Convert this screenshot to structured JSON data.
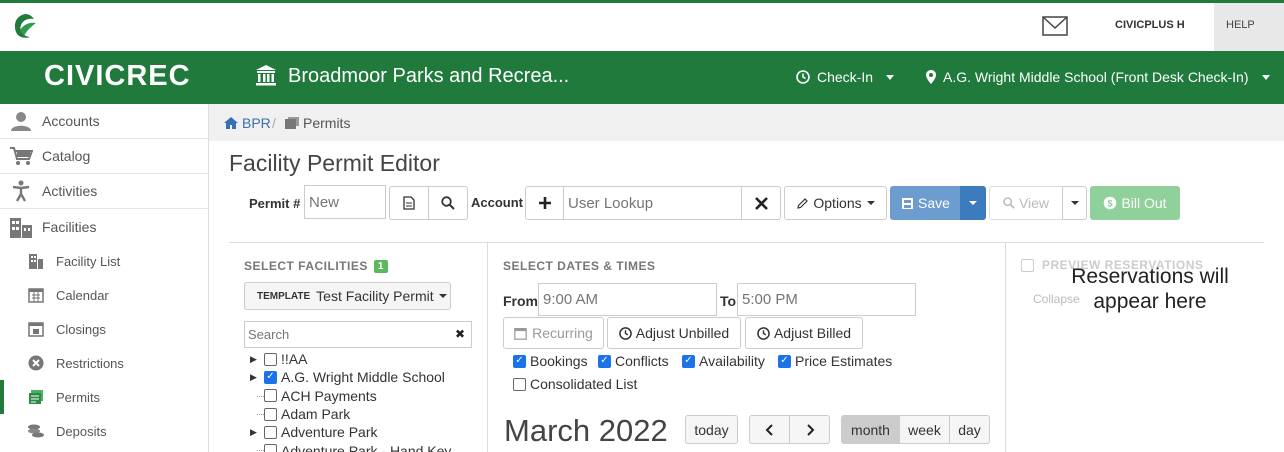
{
  "topbar": {
    "logo_icon": "civicplus-leaf-icon",
    "mail_icon": "envelope-icon",
    "user_name": "CIVICPLUS H",
    "help_label": "HELP"
  },
  "header": {
    "brand": "CIVICREC",
    "org_icon": "building-columns-icon",
    "org_name": "Broadmoor Parks and Recrea...",
    "checkin_label": "Check-In",
    "location_label": "A.G. Wright Middle School (Front Desk Check-In)",
    "brand_color": "#1f7a3c"
  },
  "sidebar": {
    "items": [
      {
        "label": "Accounts",
        "icon": "user-icon"
      },
      {
        "label": "Catalog",
        "icon": "cart-icon"
      },
      {
        "label": "Activities",
        "icon": "person-activity-icon"
      },
      {
        "label": "Facilities",
        "icon": "buildings-icon"
      }
    ],
    "sub_items": [
      {
        "label": "Facility List",
        "icon": "building-icon"
      },
      {
        "label": "Calendar",
        "icon": "calendar-icon"
      },
      {
        "label": "Closings",
        "icon": "calendar-closed-icon"
      },
      {
        "label": "Restrictions",
        "icon": "x-circle-icon"
      },
      {
        "label": "Permits",
        "icon": "permit-icon"
      },
      {
        "label": "Deposits",
        "icon": "coins-icon"
      }
    ]
  },
  "breadcrumb": {
    "home": "BPR",
    "separator": "/",
    "current": "Permits"
  },
  "page": {
    "title": "Facility Permit Editor"
  },
  "toolbar": {
    "permit_label": "Permit #",
    "permit_placeholder": "New",
    "account_label": "Account",
    "user_lookup_placeholder": "User Lookup",
    "options_label": "Options",
    "save_label": "Save",
    "view_label": "View",
    "bill_out_label": "Bill Out"
  },
  "facilities": {
    "section_title": "SELECT FACILITIES",
    "count": "1",
    "template_prefix": "TEMPLATE",
    "template_value": "Test Facility Permit",
    "search_placeholder": "Search",
    "tree": [
      {
        "label": "!!AA",
        "checked": false,
        "expandable": true
      },
      {
        "label": "A.G. Wright Middle School",
        "checked": true,
        "expandable": true
      },
      {
        "label": "ACH Payments",
        "checked": false,
        "expandable": false
      },
      {
        "label": "Adam Park",
        "checked": false,
        "expandable": false
      },
      {
        "label": "Adventure Park",
        "checked": false,
        "expandable": true
      },
      {
        "label": "Adventure Park - Hand Key",
        "checked": false,
        "expandable": false
      }
    ]
  },
  "dates": {
    "section_title": "SELECT DATES & TIMES",
    "from_label": "From",
    "from_placeholder": "9:00 AM",
    "to_label": "To",
    "to_placeholder": "5:00 PM",
    "recurring_label": "Recurring",
    "adjust_unbilled_label": "Adjust Unbilled",
    "adjust_billed_label": "Adjust Billed",
    "checks": [
      {
        "label": "Bookings",
        "checked": true
      },
      {
        "label": "Conflicts",
        "checked": true
      },
      {
        "label": "Availability",
        "checked": true
      },
      {
        "label": "Price Estimates",
        "checked": true
      },
      {
        "label": "Consolidated List",
        "checked": false
      }
    ],
    "month_title": "March 2022",
    "today_label": "today",
    "views": [
      "month",
      "week",
      "day"
    ],
    "active_view": "month"
  },
  "preview": {
    "section_title": "PREVIEW RESERVATIONS",
    "collapse_label": "Collapse",
    "empty_message": "Reservations will appear here"
  }
}
